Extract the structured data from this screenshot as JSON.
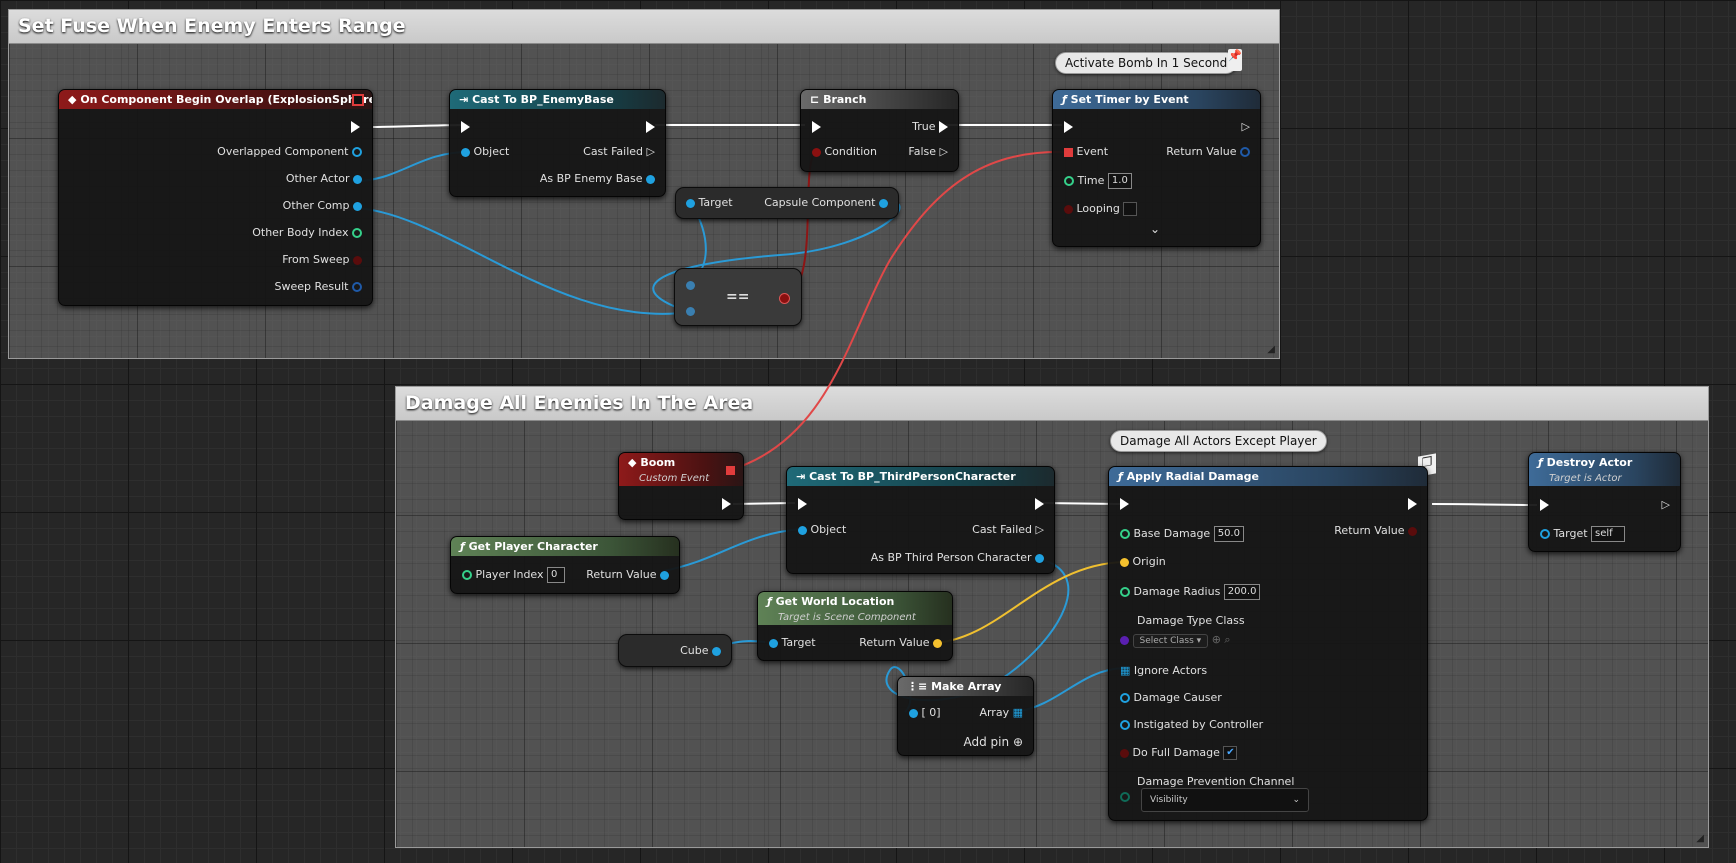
{
  "comments": {
    "top": {
      "title": "Set Fuse When Enemy Enters Range"
    },
    "bottom": {
      "title": "Damage All Enemies In The Area"
    }
  },
  "bubbles": {
    "timer": "Activate Bomb In 1 Second",
    "damage": "Damage All Actors Except Player"
  },
  "nodes": {
    "overlap": {
      "title": "On Component Begin Overlap (ExplosionSphere)",
      "pins": [
        "Overlapped Component",
        "Other Actor",
        "Other Comp",
        "Other Body Index",
        "From Sweep",
        "Sweep Result"
      ]
    },
    "cast_enemy": {
      "title": "Cast To BP_EnemyBase",
      "object": "Object",
      "cast_failed": "Cast Failed",
      "as": "As BP Enemy Base"
    },
    "branch": {
      "title": "Branch",
      "condition": "Condition",
      "true": "True",
      "false": "False"
    },
    "timer": {
      "title": "Set Timer by Event",
      "event": "Event",
      "return": "Return Value",
      "time": "Time",
      "time_value": "1.0",
      "looping": "Looping",
      "expand": "⌄"
    },
    "capsule": {
      "target": "Target",
      "output": "Capsule Component"
    },
    "equals": {
      "label": "=="
    },
    "boom": {
      "title": "Boom",
      "subtitle": "Custom Event"
    },
    "cast_player": {
      "title": "Cast To BP_ThirdPersonCharacter",
      "object": "Object",
      "cast_failed": "Cast Failed",
      "as": "As BP Third Person Character"
    },
    "get_player": {
      "title": "Get Player Character",
      "index_label": "Player Index",
      "index_value": "0",
      "return": "Return Value"
    },
    "world_loc": {
      "title": "Get World Location",
      "subtitle": "Target is Scene Component",
      "target": "Target",
      "return": "Return Value"
    },
    "cube": {
      "label": "Cube"
    },
    "make_array": {
      "title": "Make Array",
      "item": "[ 0]",
      "array": "Array",
      "add_pin": "Add pin"
    },
    "radial": {
      "title": "Apply Radial Damage",
      "base_damage": "Base Damage",
      "base_damage_value": "50.0",
      "return": "Return Value",
      "origin": "Origin",
      "radius": "Damage Radius",
      "radius_value": "200.0",
      "type_class": "Damage Type Class",
      "select_class": "Select Class",
      "ignore": "Ignore Actors",
      "causer": "Damage Causer",
      "instigated": "Instigated by Controller",
      "full_damage": "Do Full Damage",
      "channel": "Damage Prevention Channel",
      "channel_value": "Visibility"
    },
    "destroy": {
      "title": "Destroy Actor",
      "subtitle": "Target is Actor",
      "target": "Target",
      "target_value": "self"
    }
  },
  "icons": {
    "event": "diamond-icon",
    "function": "function-f-icon",
    "cast": "cast-arrows-icon",
    "branch": "branch-icon",
    "array": "array-grid-icon",
    "pin": "pushpin-icon",
    "latent": "latent-cube-icon"
  },
  "colors": {
    "exec": "#ffffff",
    "object": "#1fa1e0",
    "bool": "#8b1010",
    "int": "#35d08a",
    "vector": "#f5c12e",
    "class": "#5a1fb0",
    "struct": "#1f5aa8",
    "event_delegate": "#e03c3c",
    "wire_event": "#e04848"
  }
}
